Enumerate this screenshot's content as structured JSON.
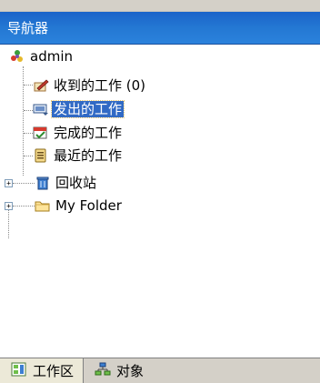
{
  "panel": {
    "title": "导航器"
  },
  "tree": {
    "root_label": "admin",
    "items": [
      {
        "label": "收到的工作 (0)",
        "icon": "inbox-pen-icon"
      },
      {
        "label": "发出的工作",
        "icon": "outbox-icon",
        "selected": true
      },
      {
        "label": "完成的工作",
        "icon": "completed-icon"
      },
      {
        "label": "最近的工作",
        "icon": "recent-icon"
      }
    ],
    "collapsed": [
      {
        "label": "回收站",
        "icon": "recycle-bin-icon"
      },
      {
        "label": "My Folder",
        "icon": "folder-icon"
      }
    ]
  },
  "bottom_tabs": [
    {
      "label": "工作区",
      "icon": "workspace-icon",
      "active": true
    },
    {
      "label": "对象",
      "icon": "objects-icon",
      "active": false
    }
  ],
  "colors": {
    "title_bar": "#2478d3",
    "selection": "#316ac5"
  }
}
